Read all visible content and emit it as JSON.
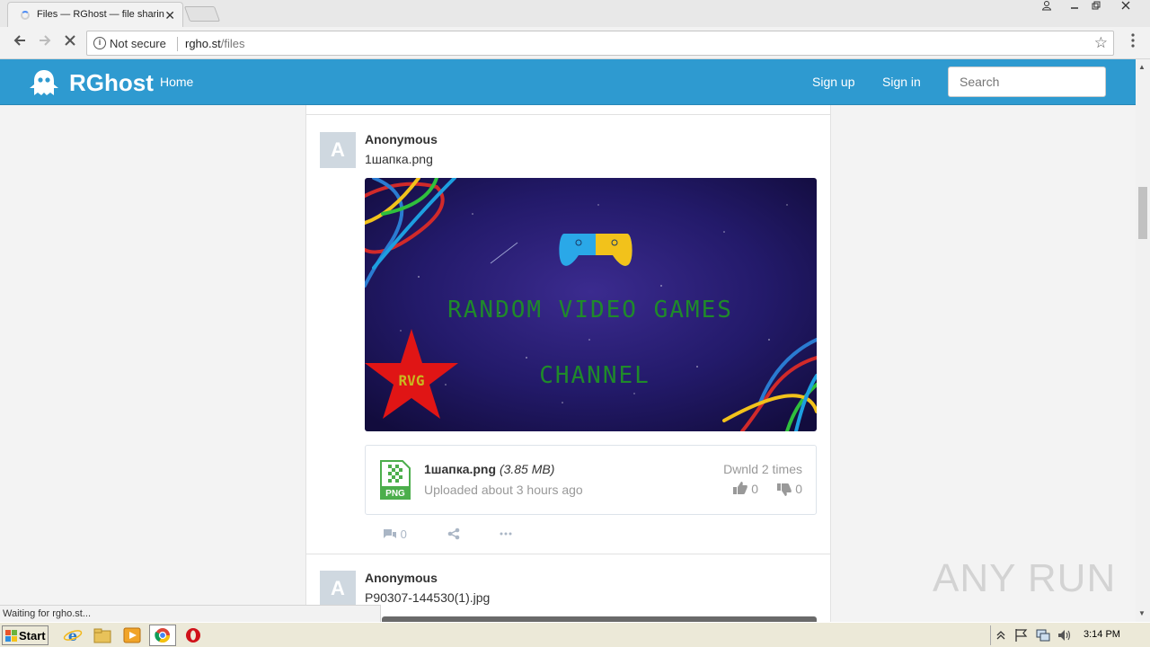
{
  "browser": {
    "tab_title": "Files — RGhost — file sharin",
    "tab_close": "✕",
    "security_label": "Not secure",
    "url_host": "rgho.st",
    "url_path": "/files",
    "status_text": "Waiting for rgho.st..."
  },
  "site": {
    "logo_text": "RGhost",
    "nav_home": "Home",
    "nav_signup": "Sign up",
    "nav_signin": "Sign in",
    "search_placeholder": "Search",
    "brand_color": "#2e9ad0"
  },
  "posts": [
    {
      "avatar_letter": "A",
      "author": "Anonymous",
      "filename": "1шапка.png",
      "preview_text_1": "RANDOM VIDEO GAMES",
      "preview_text_2": "CHANNEL",
      "preview_badge": "RVG",
      "file_icon_label": "PNG",
      "card_name": "1шапка.png",
      "card_size": "(3.85 MB)",
      "card_uploaded": "Uploaded about 3 hours ago",
      "card_downloads": "Dwnld 2 times",
      "likes": "0",
      "dislikes": "0",
      "comments": "0"
    },
    {
      "avatar_letter": "A",
      "author": "Anonymous",
      "filename": "P90307-144530(1).jpg"
    }
  ],
  "watermark": "ANY RUN",
  "taskbar": {
    "start_label": "Start",
    "clock": "3:14 PM"
  }
}
